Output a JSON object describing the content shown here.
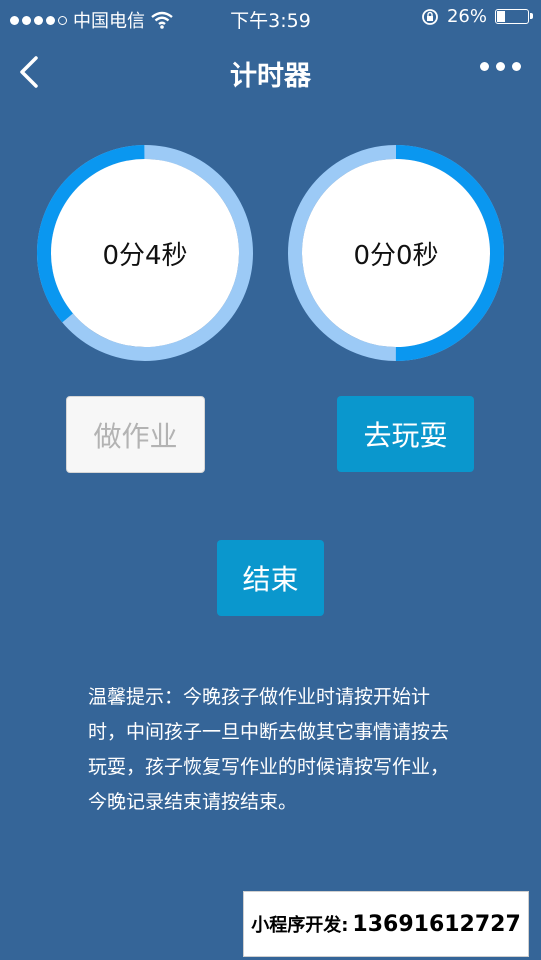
{
  "status_bar": {
    "carrier": "中国电信",
    "time": "下午3:59",
    "battery": "26%",
    "battery_level": 0.26
  },
  "nav": {
    "title": "计时器",
    "back_icon": "chevron-left-icon",
    "more_icon": "more-dots-icon"
  },
  "timers": {
    "homework": {
      "label": "0分4秒",
      "progress": 0.36
    },
    "play": {
      "label": "0分0秒",
      "progress": 0.5
    }
  },
  "buttons": {
    "homework": "做作业",
    "play": "去玩耍",
    "end": "结束"
  },
  "hint": "温馨提示：今晚孩子做作业时请按开始计时，中间孩子一旦中断去做其它事情请按去玩耍，孩子恢复写作业的时候请按写作业，今晚记录结束请按结束。",
  "banner": {
    "label": "小程序开发:",
    "phone": "13691612727"
  },
  "colors": {
    "background": "#356598",
    "ring_active": "#0a97f0",
    "ring_track": "#9ccaf6",
    "button_active": "#0a97cd"
  }
}
